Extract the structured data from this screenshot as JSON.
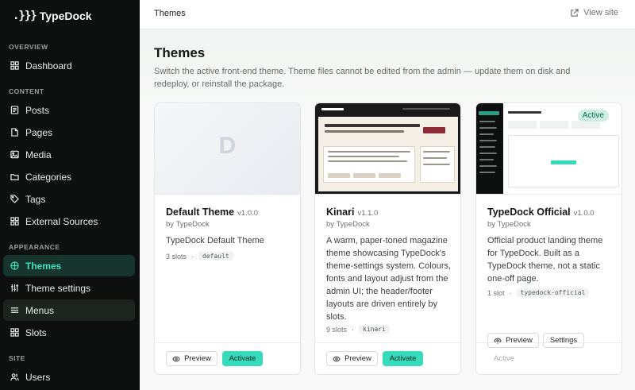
{
  "brand": {
    "mark": ".}}}",
    "name": "TypeDock"
  },
  "sidebar": {
    "sections": [
      {
        "label": "OVERVIEW"
      },
      {
        "label": "CONTENT"
      },
      {
        "label": "APPEARANCE"
      },
      {
        "label": "SITE"
      }
    ],
    "items": [
      {
        "label": "Dashboard",
        "icon": "grid-icon"
      },
      {
        "label": "Posts",
        "icon": "document-icon"
      },
      {
        "label": "Pages",
        "icon": "page-icon"
      },
      {
        "label": "Media",
        "icon": "image-icon"
      },
      {
        "label": "Categories",
        "icon": "folder-icon"
      },
      {
        "label": "Tags",
        "icon": "tag-icon"
      },
      {
        "label": "External Sources",
        "icon": "grid-icon"
      },
      {
        "label": "Themes",
        "icon": "palette-icon",
        "active": true
      },
      {
        "label": "Theme settings",
        "icon": "sliders-icon"
      },
      {
        "label": "Menus",
        "icon": "menu-icon"
      },
      {
        "label": "Slots",
        "icon": "grid-icon"
      },
      {
        "label": "Users",
        "icon": "users-icon"
      }
    ]
  },
  "topbar": {
    "breadcrumb": "Themes",
    "view_site": "View site"
  },
  "page": {
    "title": "Themes",
    "subtitle": "Switch the active front-end theme. Theme files cannot be edited from the admin — update them on disk and redeploy, or reinstall the package."
  },
  "cards": [
    {
      "thumb_letter": "D",
      "name": "Default Theme",
      "version": "v1.0.0",
      "author": "by TypeDock",
      "description": "TypeDock Default Theme",
      "slots": "3 slots",
      "sep": "·",
      "code": "default",
      "preview": "Preview",
      "activate": "Activate"
    },
    {
      "name": "Kinari",
      "version": "v1.1.0",
      "author": "by TypeDock",
      "description": "A warm, paper-toned magazine theme showcasing TypeDock's theme-settings system. Colours, fonts and layout adjust from the admin UI; the header/footer layouts are driven entirely by slots.",
      "slots": "9 slots",
      "sep": "·",
      "code": "kinari",
      "preview": "Preview",
      "activate": "Activate"
    },
    {
      "badge": "Active",
      "name": "TypeDock Official",
      "version": "v1.0.0",
      "author": "by TypeDock",
      "description": "Official product landing theme for TypeDock. Built as a TypeDock theme, not a static one-off page.",
      "slots": "1 slot",
      "sep": "·",
      "code": "typedock-official",
      "preview": "Preview",
      "settings": "Settings",
      "status": "Active"
    }
  ],
  "colors": {
    "accent": "#35dbbb",
    "sidebar_bg": "#0e100f",
    "active_nav_text": "#3fe0bd"
  }
}
